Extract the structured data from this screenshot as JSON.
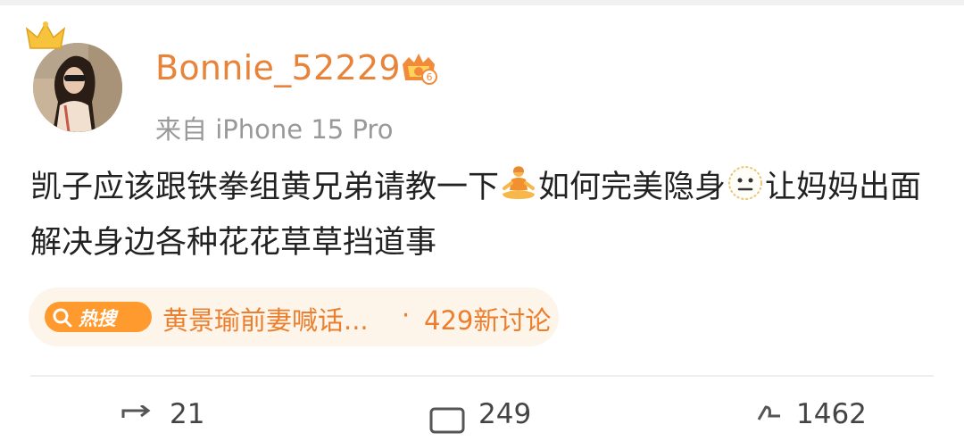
{
  "post": {
    "username": "Bonnie_52229",
    "vip_level": "6",
    "source": "来自 iPhone 15 Pro",
    "text_part1": "凯子应该跟铁拳组黄兄弟请教一下",
    "emoji1": "meditating-person-emoji",
    "text_part2": "如何完美隐身",
    "emoji2": "neutral-face-emoji",
    "text_part3": "让妈妈出面解决身边各种花花草草挡道事"
  },
  "hot_topic": {
    "badge_label": "热搜",
    "topic": "黄景瑜前妻喊话...",
    "separator": "·",
    "count": "429新讨论"
  },
  "actions": {
    "repost_count": "21",
    "comment_count": "249",
    "like_count": "1462"
  },
  "colors": {
    "username": "#e8833a",
    "hot_chip_bg": "#fdf4ea",
    "hot_badge": "#ff9a2e",
    "hot_text": "#eb7f2e"
  }
}
